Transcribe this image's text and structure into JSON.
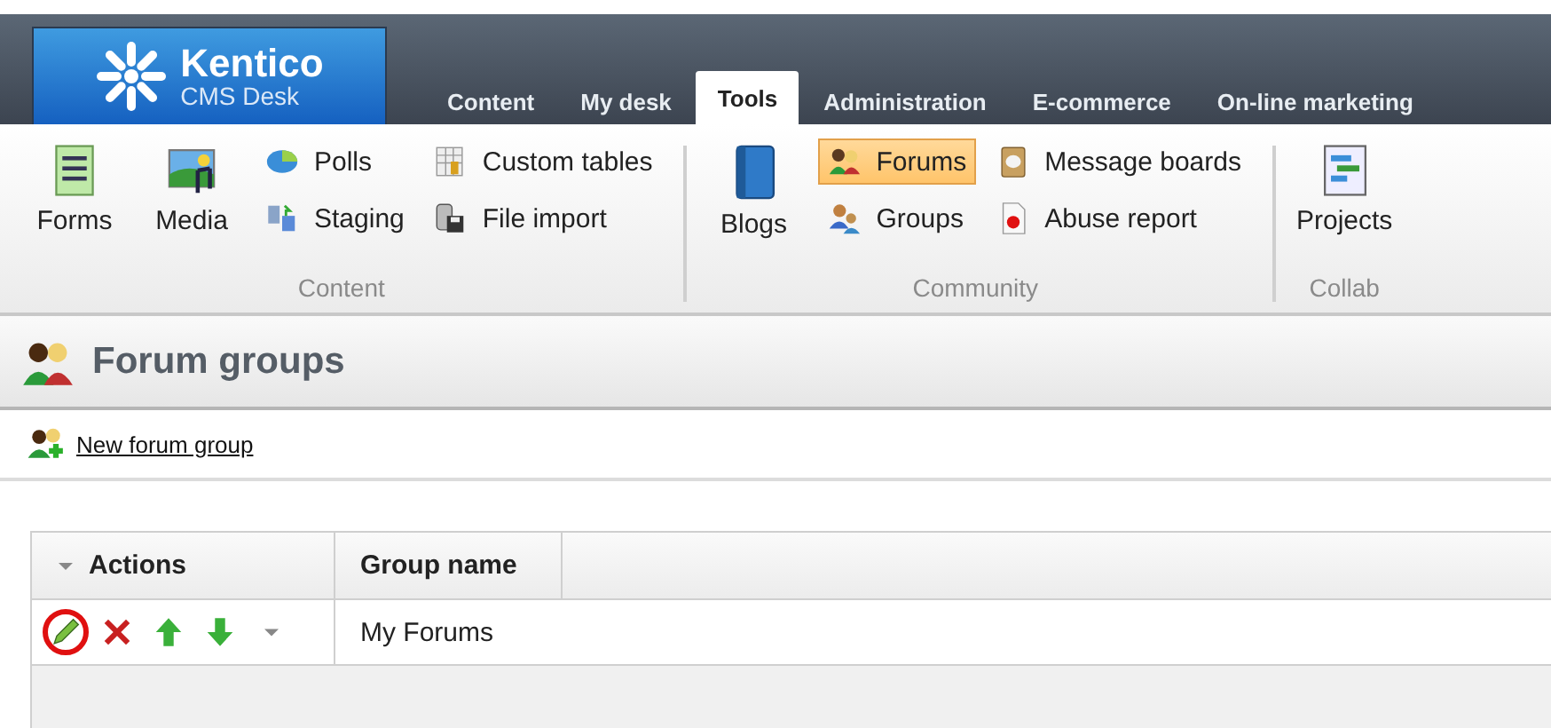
{
  "header": {
    "logo": {
      "name": "Kentico",
      "product": "CMS Desk"
    },
    "tabs": [
      {
        "label": "Content",
        "selected": false
      },
      {
        "label": "My desk",
        "selected": false
      },
      {
        "label": "Tools",
        "selected": true
      },
      {
        "label": "Administration",
        "selected": false
      },
      {
        "label": "E-commerce",
        "selected": false
      },
      {
        "label": "On-line marketing",
        "selected": false
      }
    ]
  },
  "ribbon": {
    "groups": [
      {
        "label": "Content",
        "items": [
          {
            "kind": "large",
            "label": "Forms",
            "selected": false
          },
          {
            "kind": "large",
            "label": "Media",
            "selected": false
          },
          {
            "kind": "small",
            "label": "Polls",
            "selected": false
          },
          {
            "kind": "small",
            "label": "Staging",
            "selected": false
          },
          {
            "kind": "small",
            "label": "Custom tables",
            "selected": false
          },
          {
            "kind": "small",
            "label": "File import",
            "selected": false
          }
        ]
      },
      {
        "label": "Community",
        "items": [
          {
            "kind": "large",
            "label": "Blogs",
            "selected": false
          },
          {
            "kind": "small",
            "label": "Forums",
            "selected": true
          },
          {
            "kind": "small",
            "label": "Groups",
            "selected": false
          },
          {
            "kind": "small",
            "label": "Message boards",
            "selected": false
          },
          {
            "kind": "small",
            "label": "Abuse report",
            "selected": false
          }
        ]
      },
      {
        "label": "Collab",
        "items": [
          {
            "kind": "large",
            "label": "Projects",
            "selected": false
          }
        ]
      }
    ]
  },
  "page": {
    "title": "Forum groups",
    "action": "New forum group",
    "table": {
      "columns": [
        "Actions",
        "Group name"
      ],
      "rows": [
        {
          "actions": [
            {
              "kind": "edit",
              "highlighted": true
            },
            {
              "kind": "delete",
              "highlighted": false
            },
            {
              "kind": "up",
              "highlighted": false
            },
            {
              "kind": "down",
              "highlighted": false
            },
            {
              "kind": "more",
              "highlighted": false
            }
          ],
          "group_name": "My Forums"
        }
      ]
    }
  }
}
